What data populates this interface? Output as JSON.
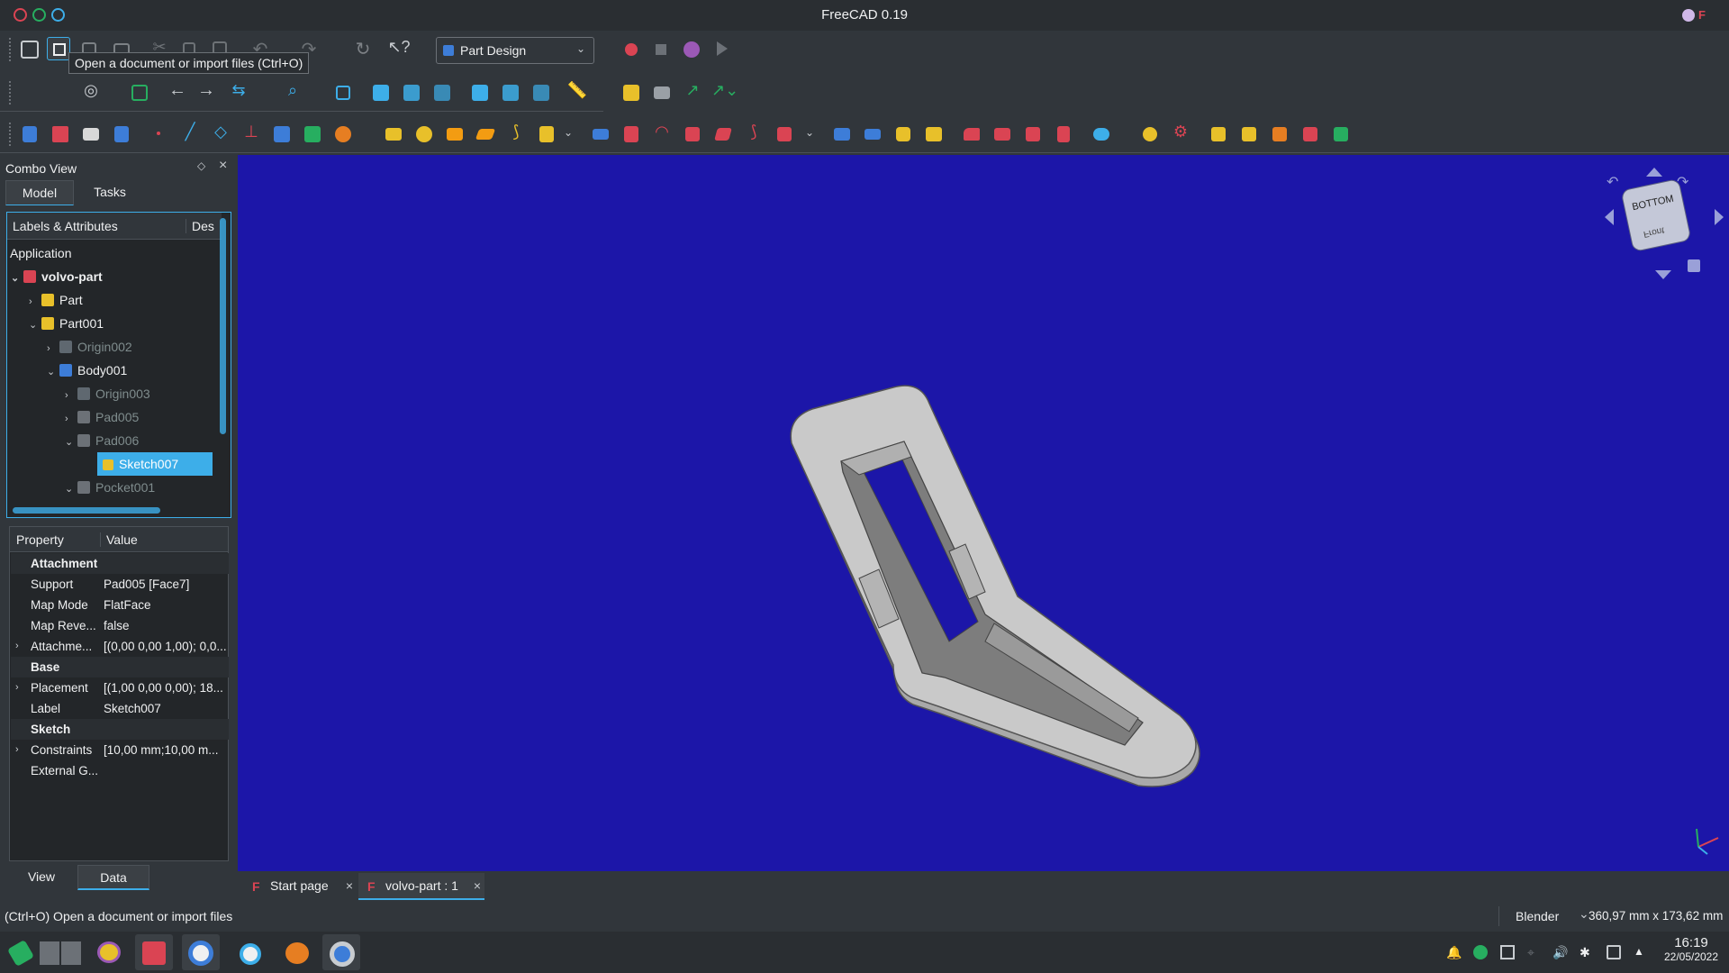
{
  "window": {
    "title": "FreeCAD 0.19"
  },
  "tooltip": "Open a document or import files (Ctrl+O)",
  "workbench": {
    "selected": "Part Design"
  },
  "combo": {
    "title": "Combo View",
    "tabs": [
      "Model",
      "Tasks"
    ],
    "tree_header": {
      "col1": "Labels & Attributes",
      "col2": "Des"
    },
    "application_label": "Application",
    "tree": [
      {
        "label": "volvo-part",
        "bold": true
      },
      {
        "label": "Part"
      },
      {
        "label": "Part001"
      },
      {
        "label": "Origin002",
        "dim": true
      },
      {
        "label": "Body001"
      },
      {
        "label": "Origin003",
        "dim": true
      },
      {
        "label": "Pad005",
        "dim": true
      },
      {
        "label": "Pad006",
        "dim": true
      },
      {
        "label": "Sketch007",
        "selected": true
      },
      {
        "label": "Pocket001",
        "dim": true
      }
    ],
    "prop_header": {
      "col1": "Property",
      "col2": "Value"
    },
    "properties": [
      {
        "key": "Attachment",
        "category": true
      },
      {
        "key": "Support",
        "value": "Pad005 [Face7]"
      },
      {
        "key": "Map Mode",
        "value": "FlatFace"
      },
      {
        "key": "Map Reve...",
        "value": "false"
      },
      {
        "key": "Attachme...",
        "value": "[(0,00 0,00 1,00); 0,0...",
        "expandable": true
      },
      {
        "key": "Base",
        "category": true
      },
      {
        "key": "Placement",
        "value": "[(1,00 0,00 0,00); 18...",
        "expandable": true
      },
      {
        "key": "Label",
        "value": "Sketch007"
      },
      {
        "key": "Sketch",
        "category": true
      },
      {
        "key": "Constraints",
        "value": "[10,00 mm;10,00 m...",
        "expandable": true
      },
      {
        "key": "External G...",
        "value": ""
      }
    ],
    "bottom_tabs": [
      "View",
      "Data"
    ]
  },
  "navcube": {
    "face_top": "BOTTOM",
    "face_side": "Front"
  },
  "doc_tabs": [
    "Start page",
    "volvo-part : 1"
  ],
  "status": {
    "message": "(Ctrl+O) Open a document or import files",
    "nav_style": "Blender",
    "dimensions": "360,97 mm x 173,62 mm"
  },
  "clock": {
    "time": "16:19",
    "date": "22/05/2022"
  },
  "colors": {
    "viewport": "#1c16a8",
    "selection": "#3daee9",
    "record": "#da4453"
  }
}
